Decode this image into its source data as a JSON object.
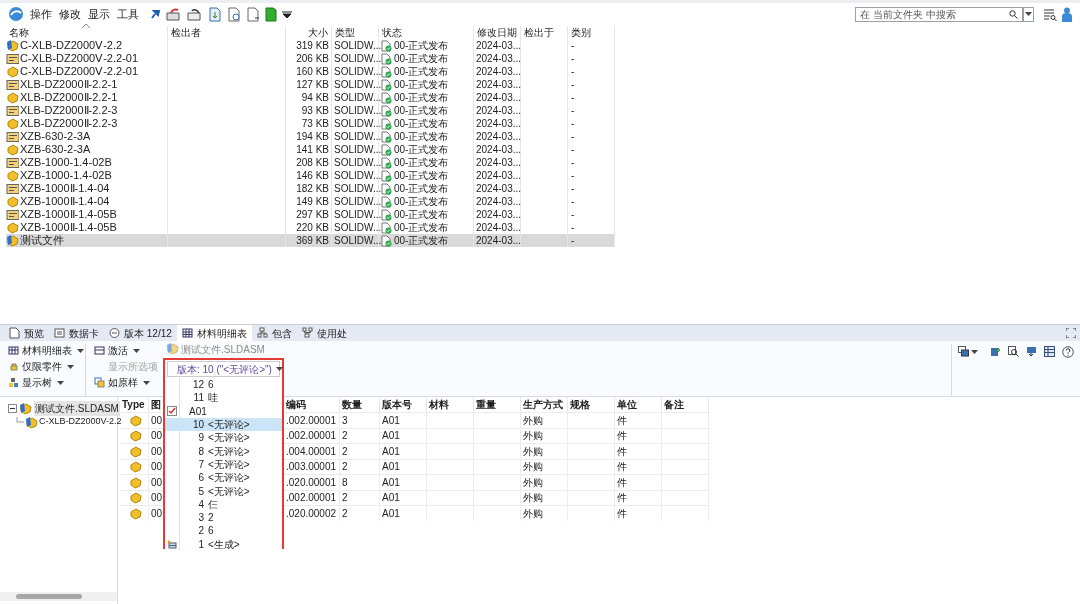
{
  "toolbar": {
    "menus": [
      "操作",
      "修改",
      "显示",
      "工具"
    ],
    "search": {
      "placeholder": "在 当前文件夹 中搜索"
    }
  },
  "file_list": {
    "columns": [
      "名称",
      "检出者",
      "大小",
      "类型",
      "状态",
      "修改日期",
      "检出于",
      "类别"
    ],
    "rows": [
      {
        "kind": "assembly",
        "name": "C-XLB-DZ2000Ⅴ-2.2",
        "size": "319 KB",
        "type": "SOLIDW...",
        "status": "00-正式发布",
        "modified": "2024-03...",
        "category": "-",
        "selected": false
      },
      {
        "kind": "drawing",
        "name": "C-XLB-DZ2000Ⅴ-2.2-01",
        "size": "206 KB",
        "type": "SOLIDW...",
        "status": "00-正式发布",
        "modified": "2024-03...",
        "category": "-",
        "selected": false
      },
      {
        "kind": "part",
        "name": "C-XLB-DZ2000Ⅴ-2.2-01",
        "size": "160 KB",
        "type": "SOLIDW...",
        "status": "00-正式发布",
        "modified": "2024-03...",
        "category": "-",
        "selected": false
      },
      {
        "kind": "drawing",
        "name": "XLB-DZ2000Ⅱ-2.2-1",
        "size": "127 KB",
        "type": "SOLIDW...",
        "status": "00-正式发布",
        "modified": "2024-03...",
        "category": "-",
        "selected": false
      },
      {
        "kind": "part",
        "name": "XLB-DZ2000Ⅱ-2.2-1",
        "size": "94 KB",
        "type": "SOLIDW...",
        "status": "00-正式发布",
        "modified": "2024-03...",
        "category": "-",
        "selected": false
      },
      {
        "kind": "drawing",
        "name": "XLB-DZ2000Ⅱ-2.2-3",
        "size": "93 KB",
        "type": "SOLIDW...",
        "status": "00-正式发布",
        "modified": "2024-03...",
        "category": "-",
        "selected": false
      },
      {
        "kind": "part",
        "name": "XLB-DZ2000Ⅱ-2.2-3",
        "size": "73 KB",
        "type": "SOLIDW...",
        "status": "00-正式发布",
        "modified": "2024-03...",
        "category": "-",
        "selected": false
      },
      {
        "kind": "drawing",
        "name": "XZB-630-2-3A",
        "size": "194 KB",
        "type": "SOLIDW...",
        "status": "00-正式发布",
        "modified": "2024-03...",
        "category": "-",
        "selected": false
      },
      {
        "kind": "part",
        "name": "XZB-630-2-3A",
        "size": "141 KB",
        "type": "SOLIDW...",
        "status": "00-正式发布",
        "modified": "2024-03...",
        "category": "-",
        "selected": false
      },
      {
        "kind": "drawing",
        "name": "XZB-1000-1.4-02B",
        "size": "208 KB",
        "type": "SOLIDW...",
        "status": "00-正式发布",
        "modified": "2024-03...",
        "category": "-",
        "selected": false
      },
      {
        "kind": "part",
        "name": "XZB-1000-1.4-02B",
        "size": "146 KB",
        "type": "SOLIDW...",
        "status": "00-正式发布",
        "modified": "2024-03...",
        "category": "-",
        "selected": false
      },
      {
        "kind": "drawing",
        "name": "XZB-1000Ⅱ-1.4-04",
        "size": "182 KB",
        "type": "SOLIDW...",
        "status": "00-正式发布",
        "modified": "2024-03...",
        "category": "-",
        "selected": false
      },
      {
        "kind": "part",
        "name": "XZB-1000Ⅱ-1.4-04",
        "size": "149 KB",
        "type": "SOLIDW...",
        "status": "00-正式发布",
        "modified": "2024-03...",
        "category": "-",
        "selected": false
      },
      {
        "kind": "drawing",
        "name": "XZB-1000Ⅱ-1.4-05B",
        "size": "297 KB",
        "type": "SOLIDW...",
        "status": "00-正式发布",
        "modified": "2024-03...",
        "category": "-",
        "selected": false
      },
      {
        "kind": "part",
        "name": "XZB-1000Ⅱ-1.4-05B",
        "size": "220 KB",
        "type": "SOLIDW...",
        "status": "00-正式发布",
        "modified": "2024-03...",
        "category": "-",
        "selected": false
      },
      {
        "kind": "assembly",
        "name": "测试文件",
        "size": "369 KB",
        "type": "SOLIDW...",
        "status": "00-正式发布",
        "modified": "2024-03...",
        "category": "-",
        "selected": true
      }
    ]
  },
  "tabs": [
    {
      "label": "预览",
      "selected": false
    },
    {
      "label": "数据卡",
      "selected": false
    },
    {
      "label": "版本 12/12",
      "selected": false
    },
    {
      "label": "材料明细表",
      "selected": true
    },
    {
      "label": "包含",
      "selected": false
    },
    {
      "label": "使用处",
      "selected": false
    }
  ],
  "ribbon": {
    "columns": [
      [
        {
          "label": "材料明细表",
          "disabled": false
        },
        {
          "label": "仅限零件",
          "disabled": false
        },
        {
          "label": "显示树",
          "disabled": false
        }
      ],
      [
        {
          "label": "激活",
          "disabled": false
        },
        {
          "label": "显示所选项",
          "disabled": true
        },
        {
          "label": "如原样",
          "disabled": false
        }
      ]
    ],
    "file_label": "测试文件.SLDASM"
  },
  "version_dropdown": {
    "button": "版本: 10 (\"<无评论>\")",
    "items": [
      {
        "kind": "version",
        "number": "12",
        "comment": "6",
        "selected": false
      },
      {
        "kind": "version",
        "number": "11",
        "comment": "哇",
        "selected": false
      },
      {
        "kind": "revision",
        "number": "A01",
        "checked": true,
        "selected": false
      },
      {
        "kind": "version",
        "number": "10",
        "comment": "<无评论>",
        "selected": true
      },
      {
        "kind": "version",
        "number": "9",
        "comment": "<无评论>",
        "selected": false
      },
      {
        "kind": "version",
        "number": "8",
        "comment": "<无评论>",
        "selected": false
      },
      {
        "kind": "version",
        "number": "7",
        "comment": "<无评论>",
        "selected": false
      },
      {
        "kind": "version",
        "number": "6",
        "comment": "<无评论>",
        "selected": false
      },
      {
        "kind": "version",
        "number": "5",
        "comment": "<无评论>",
        "selected": false
      },
      {
        "kind": "version",
        "number": "4",
        "comment": "仨",
        "selected": false
      },
      {
        "kind": "version",
        "number": "3",
        "comment": "2",
        "selected": false
      },
      {
        "kind": "version",
        "number": "2",
        "comment": "6",
        "selected": false
      },
      {
        "kind": "initial",
        "number": "1",
        "comment": "<生成>",
        "selected": false
      }
    ]
  },
  "tree": {
    "label": "测试文件.SLDASM",
    "selected": true,
    "expanded": true,
    "children": [
      {
        "label": "C-XLB-DZ2000V-2.2"
      }
    ]
  },
  "bom_table": {
    "columns": [
      "Type",
      "图",
      "编码",
      "数量",
      "版本号",
      "材料",
      "重量",
      "生产方式",
      "规格",
      "单位",
      "备注"
    ],
    "rows": [
      {
        "drawing_no": "00",
        "code": ".002.00001",
        "quantity": "3",
        "revision": "A01",
        "production": "外购",
        "unit": "件"
      },
      {
        "drawing_no": "00",
        "code": ".002.00001",
        "quantity": "2",
        "revision": "A01",
        "production": "外购",
        "unit": "件"
      },
      {
        "drawing_no": "00",
        "code": ".004.00001",
        "quantity": "2",
        "revision": "A01",
        "production": "外购",
        "unit": "件"
      },
      {
        "drawing_no": "00",
        "code": ".003.00001",
        "quantity": "2",
        "revision": "A01",
        "production": "外购",
        "unit": "件"
      },
      {
        "drawing_no": "00",
        "code": ".020.00001",
        "quantity": "8",
        "revision": "A01",
        "production": "外购",
        "unit": "件"
      },
      {
        "drawing_no": "00",
        "code": ".002.00001",
        "quantity": "2",
        "revision": "A01",
        "production": "外购",
        "unit": "件"
      },
      {
        "drawing_no": "00",
        "code": ".020.00002",
        "quantity": "2",
        "revision": "A01",
        "production": "外购",
        "unit": "件"
      }
    ]
  }
}
